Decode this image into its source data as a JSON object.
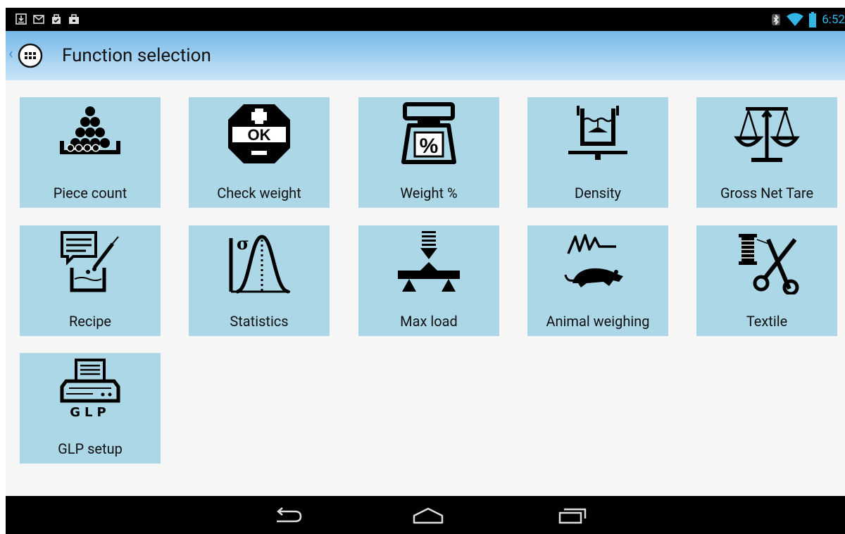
{
  "status_bar": {
    "time": "6:52",
    "notification_icons": [
      "download-icon",
      "gmail-icon",
      "clipboard-icon",
      "briefcase-icon"
    ],
    "system_icons": [
      "bluetooth-icon",
      "wifi-icon",
      "battery-icon"
    ]
  },
  "action_bar": {
    "title": "Function selection",
    "up_glyph": "‹"
  },
  "functions": [
    {
      "label": "Piece count",
      "icon": "piece-count-icon"
    },
    {
      "label": "Check weight",
      "icon": "check-weight-icon"
    },
    {
      "label": "Weight %",
      "icon": "weight-percent-icon"
    },
    {
      "label": "Density",
      "icon": "density-icon"
    },
    {
      "label": "Gross Net Tare",
      "icon": "gross-net-tare-icon"
    },
    {
      "label": "Recipe",
      "icon": "recipe-icon"
    },
    {
      "label": "Statistics",
      "icon": "statistics-icon"
    },
    {
      "label": "Max load",
      "icon": "max-load-icon"
    },
    {
      "label": "Animal weighing",
      "icon": "animal-weighing-icon"
    },
    {
      "label": "Textile",
      "icon": "textile-icon"
    },
    {
      "label": "GLP setup",
      "icon": "glp-setup-icon",
      "icon_text": "GLP"
    }
  ],
  "check_weight_badge": "OK",
  "statistics_symbol": "σ",
  "weight_percent_symbol": "%",
  "colors": {
    "tile_bg": "#abd7e6",
    "action_bar_top": "#75b9e8",
    "time_text": "#33b5e5"
  }
}
